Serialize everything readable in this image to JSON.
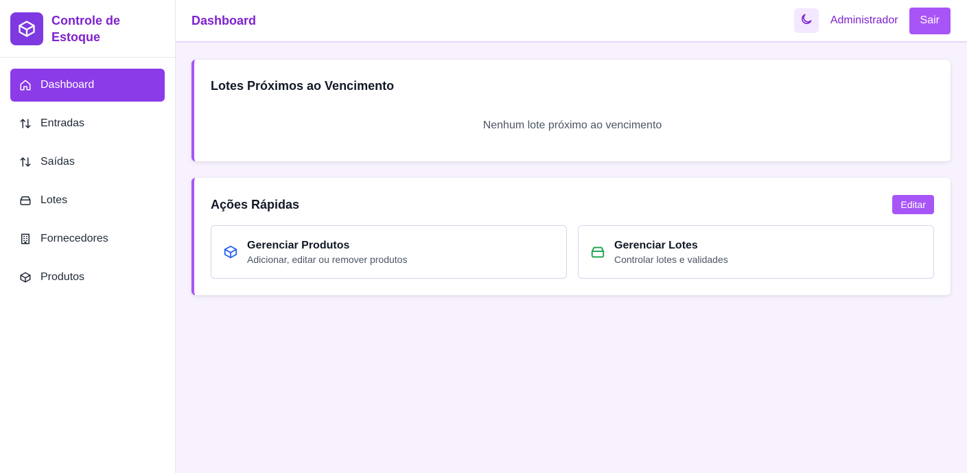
{
  "brand": {
    "title": "Controle de Estoque",
    "icon": "box-icon",
    "color": "#7e3ae0"
  },
  "sidebar": {
    "items": [
      {
        "label": "Dashboard",
        "icon": "home-icon",
        "active": true
      },
      {
        "label": "Entradas",
        "icon": "arrows-up-down-icon",
        "active": false
      },
      {
        "label": "Saídas",
        "icon": "arrows-up-down-icon",
        "active": false
      },
      {
        "label": "Lotes",
        "icon": "archive-icon",
        "active": false
      },
      {
        "label": "Fornecedores",
        "icon": "building-icon",
        "active": false
      },
      {
        "label": "Produtos",
        "icon": "box-icon",
        "active": false
      }
    ]
  },
  "header": {
    "title": "Dashboard",
    "theme_toggle_icon": "moon-icon",
    "user": "Administrador",
    "logout_label": "Sair"
  },
  "expiring": {
    "title": "Lotes Próximos ao Vencimento",
    "empty_text": "Nenhum lote próximo ao vencimento"
  },
  "quick_actions": {
    "title": "Ações Rápidas",
    "edit_label": "Editar",
    "items": [
      {
        "title": "Gerenciar Produtos",
        "desc": "Adicionar, editar ou remover produtos",
        "icon": "box-icon",
        "color": "#2563eb"
      },
      {
        "title": "Gerenciar Lotes",
        "desc": "Controlar lotes e validades",
        "icon": "archive-icon",
        "color": "#16a34a"
      }
    ]
  },
  "colors": {
    "accent": "#a855f7",
    "active_nav": "#8b3be8",
    "brand_text": "#7e22ce",
    "background": "#f7f2fe"
  }
}
